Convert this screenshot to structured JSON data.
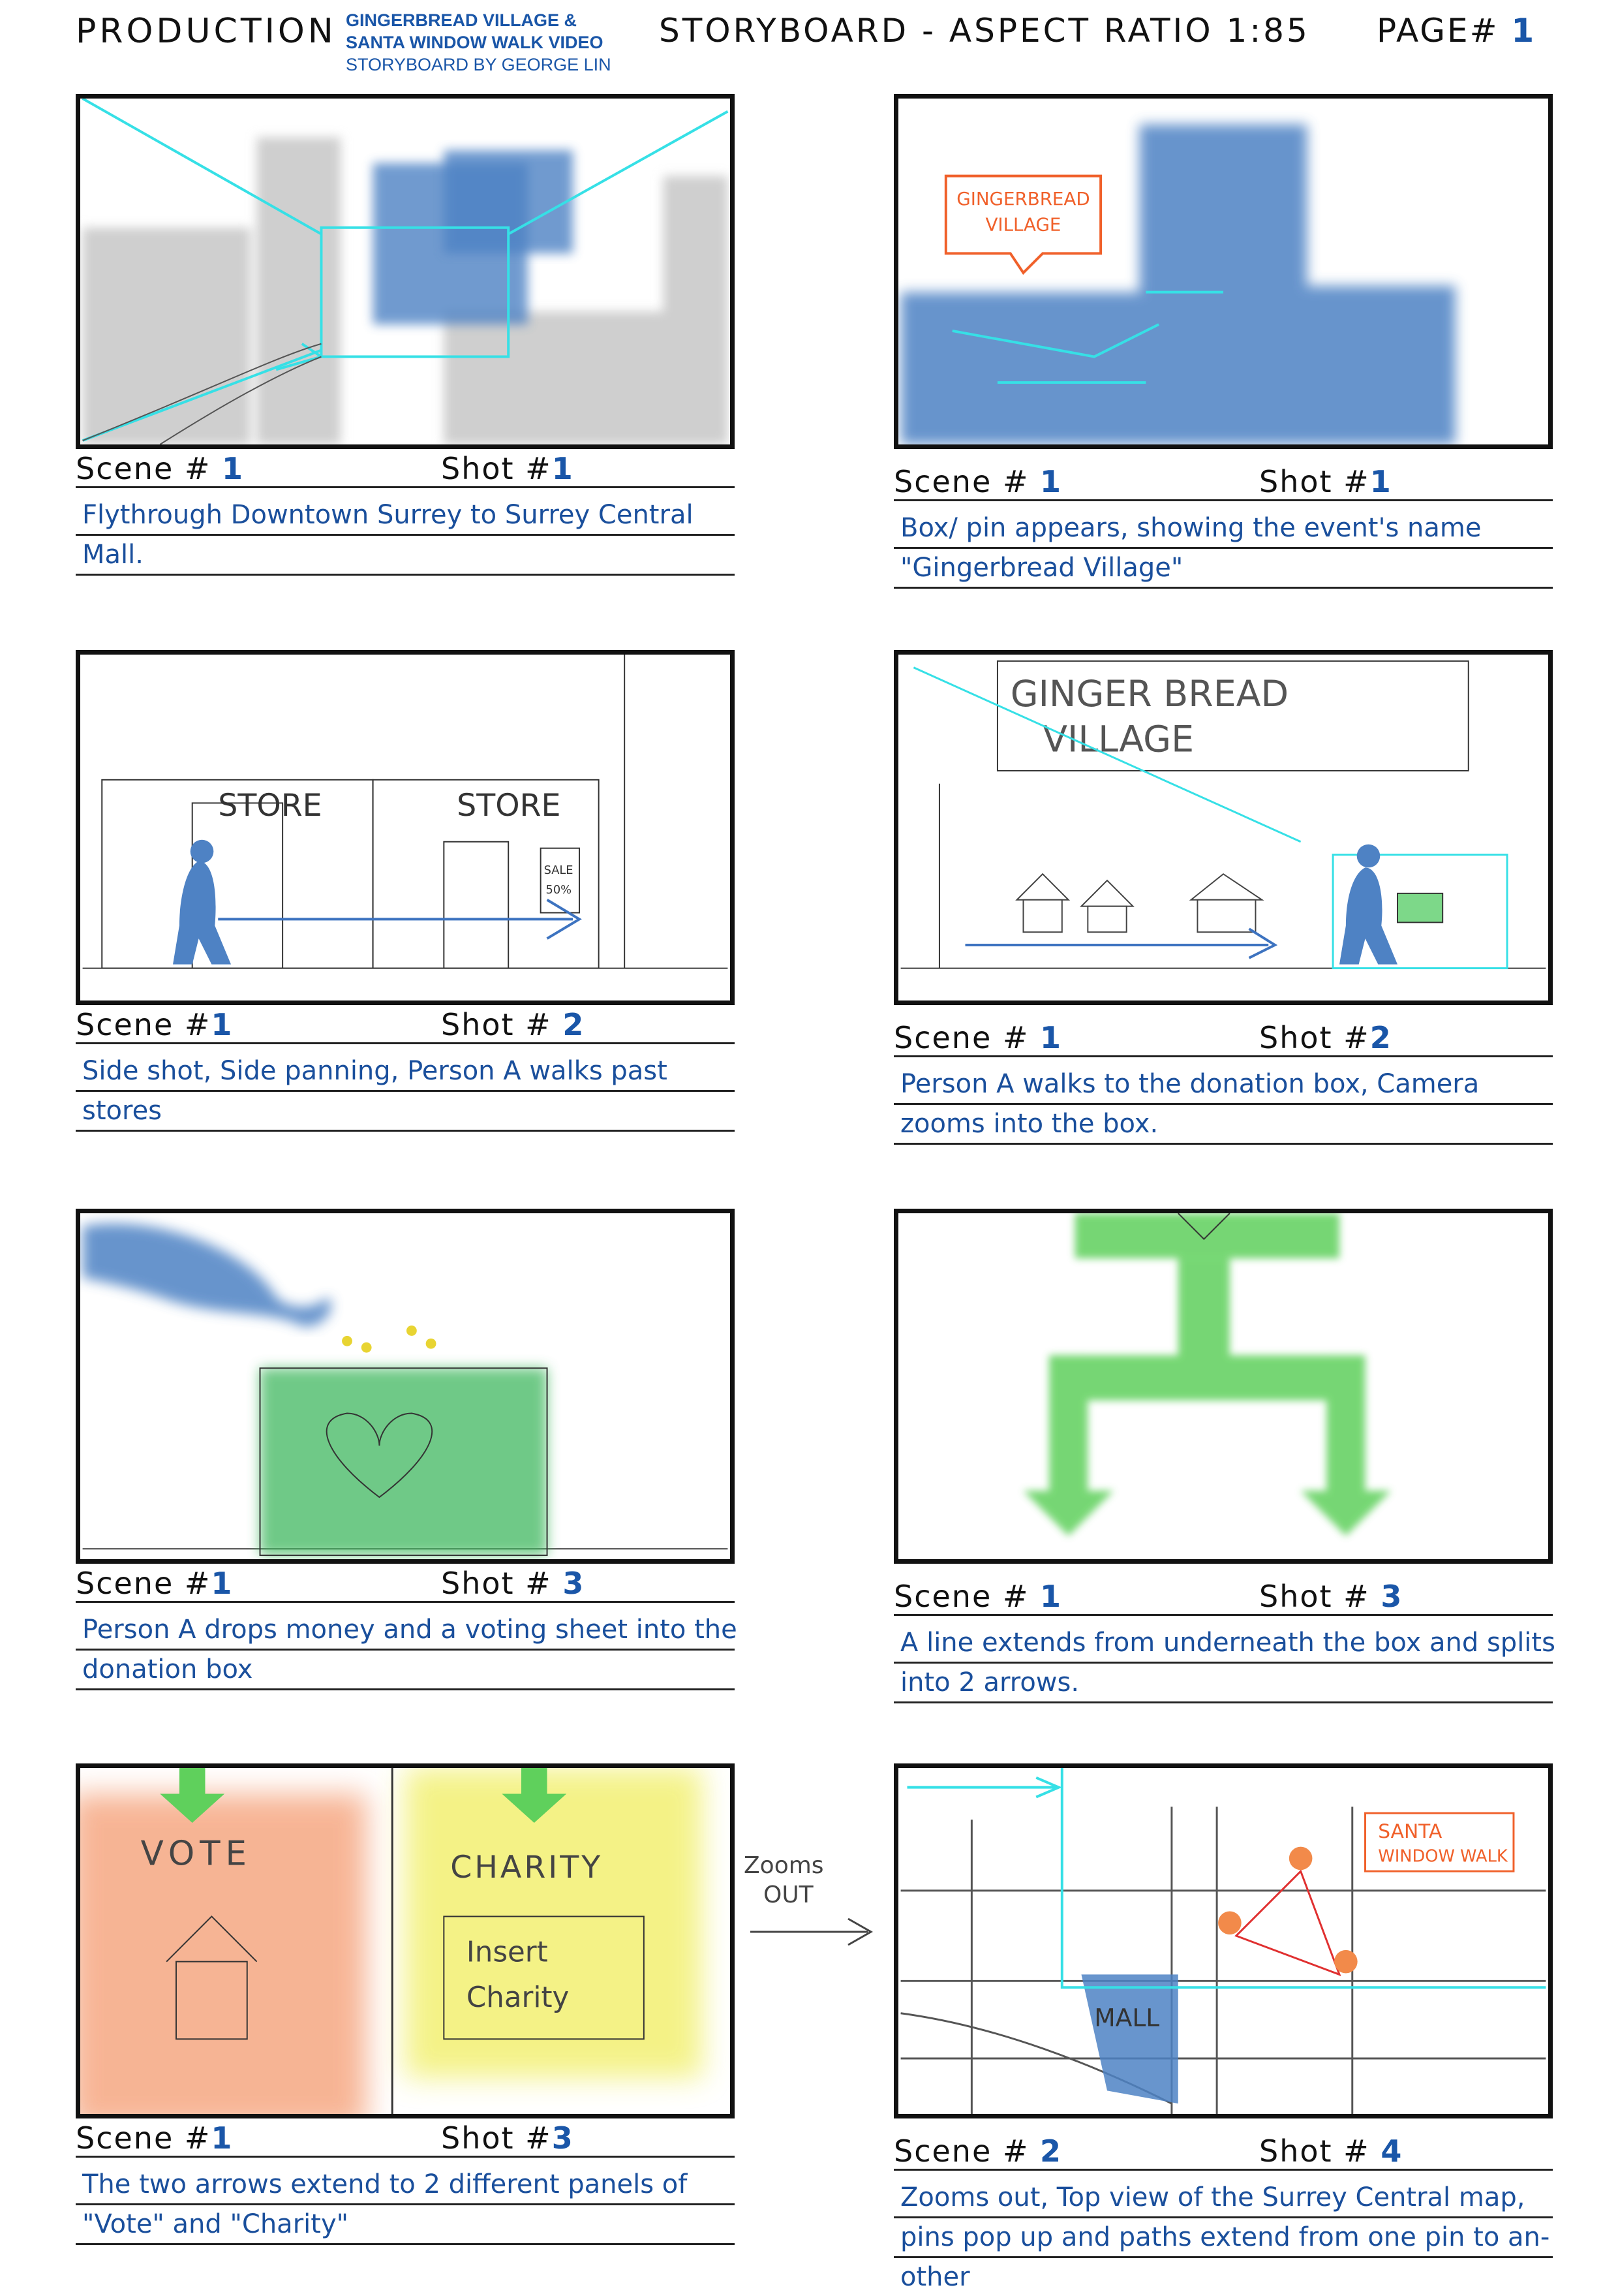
{
  "header": {
    "production": "PRODUCTION",
    "project_line1": "GINGERBREAD VILLAGE &",
    "project_line2": "SANTA WINDOW WALK VIDEO",
    "storyboard_by": "STORYBOARD BY GEORGE LIN",
    "storyboard": "STORYBOARD - ASPECT RATIO 1:85",
    "page_label": "PAGE#",
    "page_number": "1"
  },
  "labels": {
    "scene": "Scene #",
    "shot": "Shot #"
  },
  "panels": [
    {
      "scene": "1",
      "shot": "1",
      "desc_lines": [
        "Flythrough Downtown Surrey to Surrey Central",
        "Mall."
      ]
    },
    {
      "scene": "1",
      "shot": "1",
      "desc_lines": [
        "Box/ pin appears, showing the event's name",
        "\"Gingerbread Village\""
      ]
    },
    {
      "scene": "1",
      "shot": "2",
      "desc_lines": [
        "Side shot, Side panning, Person A walks past",
        "stores"
      ]
    },
    {
      "scene": "1",
      "shot": "2",
      "desc_lines": [
        "Person A walks to the donation box, Camera",
        "zooms into the box."
      ]
    },
    {
      "scene": "1",
      "shot": "3",
      "desc_lines": [
        "Person A drops money and a voting sheet into the",
        "donation box"
      ]
    },
    {
      "scene": "1",
      "shot": "3",
      "desc_lines": [
        "A line extends from underneath the box and splits",
        "into 2 arrows."
      ]
    },
    {
      "scene": "1",
      "shot": "3",
      "desc_lines": [
        "The two arrows extend to 2 different panels of",
        "\"Vote\" and \"Charity\""
      ]
    },
    {
      "scene": "2",
      "shot": "4",
      "desc_lines": [
        "Zooms out, Top view of the Surrey Central map,",
        "pins pop up and paths extend from one pin to an-",
        "other"
      ]
    }
  ],
  "sketch_text": {
    "gingerbread_pin_line1": "GINGERBREAD",
    "gingerbread_pin_line2": "VILLAGE",
    "store_sign": "STORE",
    "sale_sign": "SALE",
    "sale_pct": "50%",
    "gingerbread_sign_line1": "GINGER BREAD",
    "gingerbread_sign_line2": "VILLAGE",
    "vote": "VOTE",
    "charity": "CHARITY",
    "insert_line1": "Insert",
    "insert_line2": "Charity",
    "zooms": "Zooms",
    "out": "OUT",
    "santa_line1": "SANTA",
    "santa_line2": "WINDOW WALK",
    "mall": "MALL"
  },
  "colors": {
    "accent_blue": "#1a56a8",
    "cyan": "#36e0e6",
    "building_blue": "#4e82c4",
    "green": "#5fd05c",
    "orange": "#f0602a",
    "yellow": "#f3f17a"
  }
}
